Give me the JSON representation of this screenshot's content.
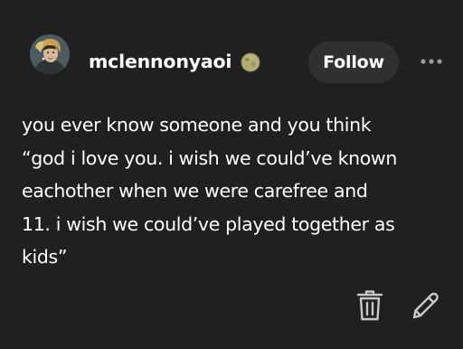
{
  "post": {
    "username": "mclennonyaoi",
    "follow_label": "Follow",
    "lines": [
      "you ever know someone and you think",
      "“god i love you. i wish we could’ve known",
      "eachother when we were carefree and",
      "11. i wish we could’ve played together as",
      "kids”"
    ]
  },
  "icons": {
    "avatar": "avatar",
    "badge": "moon-badge-icon",
    "more": "more-icon",
    "trash": "trash-icon",
    "edit": "pencil-icon"
  },
  "colors": {
    "background": "#202020",
    "text": "#ffffff",
    "button_bg": "#303030",
    "icon": "#c8c8c8"
  }
}
